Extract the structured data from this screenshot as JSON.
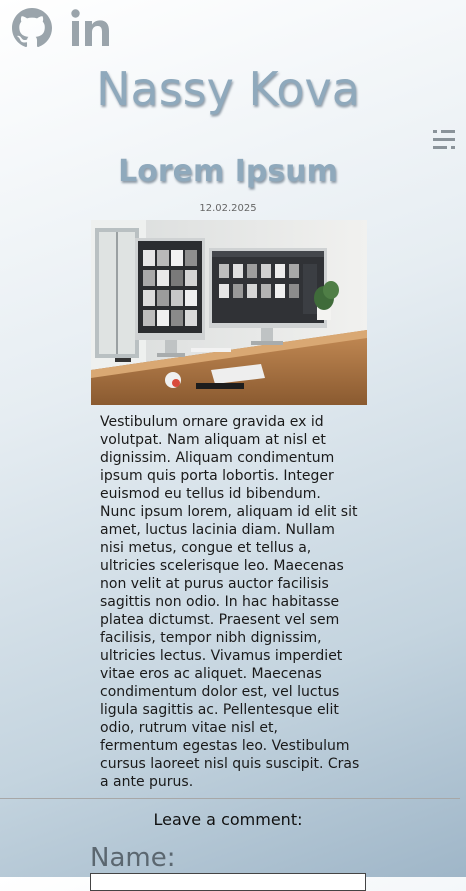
{
  "header": {
    "site_title": "Nassy Kova",
    "social_icons": [
      "github-icon",
      "linkedin-icon"
    ],
    "menu_icon": "menu-icon"
  },
  "post": {
    "title": "Lorem Ipsum",
    "date": "12.02.2025",
    "image_description": "desk-with-two-monitors",
    "body": "Vestibulum ornare gravida ex id volutpat. Nam aliquam at nisl et dignissim. Aliquam condimentum ipsum quis porta lobortis. Integer euismod eu tellus id bibendum. Nunc ipsum lorem, aliquam id elit sit amet, luctus lacinia diam. Nullam nisi metus, congue et tellus a, ultricies scelerisque leo. Maecenas non velit at purus auctor facilisis sagittis non odio. In hac habitasse platea dictumst. Praesent vel sem facilisis, tempor nibh dignissim, ultricies lectus. Vivamus imperdiet vitae eros ac aliquet. Maecenas condimentum dolor est, vel luctus ligula sagittis ac. Pellentesque elit odio, rutrum vitae nisl et, fermentum egestas leo. Vestibulum cursus laoreet nisl quis suscipit. Cras a ante purus."
  },
  "comments": {
    "heading": "Leave a comment:",
    "name_label": "Name:",
    "name_value": ""
  },
  "colors": {
    "title": "#8fa9bc",
    "icon": "#9aa4ab",
    "text": "#1a1a1a"
  }
}
